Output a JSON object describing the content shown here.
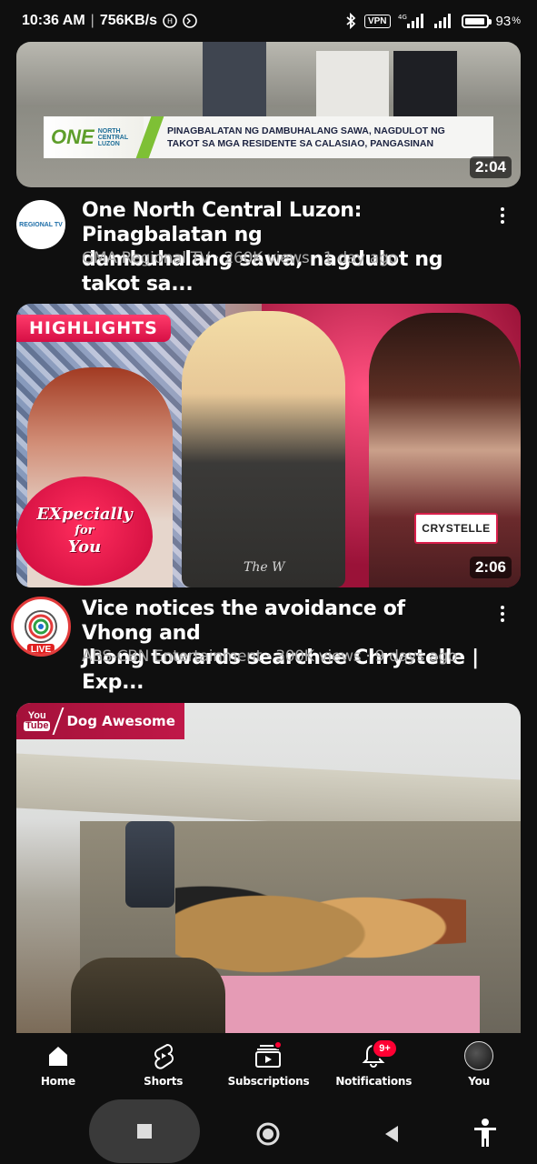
{
  "status_bar": {
    "time": "10:36 AM",
    "speed": "756KB/s",
    "vpn": "VPN",
    "network": "4G",
    "battery": "93",
    "battery_level": 0.93
  },
  "videos": [
    {
      "title_line1": "One North Central Luzon: Pinagbalatan ng",
      "title_line2": "dambuhalang sawa, nagdulot ng takot sa...",
      "subtitle": "GMA Regional TV · 260K views · 1 day ago",
      "duration": "2:04",
      "avatar_text": "REGIONAL TV",
      "lower_third_logo": "ONE",
      "lower_third_logo_sub": [
        "NORTH",
        "CENTRAL",
        "LUZON"
      ],
      "lower_third_line1": "PINAGBALATAN NG DAMBUHALANG SAWA, NAGDULOT NG",
      "lower_third_line2": "TAKOT SA MGA RESIDENTE SA CALASIAO, PANGASINAN"
    },
    {
      "title_line1": "Vice notices the avoidance of Vhong and",
      "title_line2": "Jhong towards searchee Chrystelle | Exp...",
      "subtitle": "ABS-CBN Entertainment · 300K views · 9 days ago",
      "duration": "2:06",
      "highlight_tag": "HIGHLIGHTS",
      "heart_line1": "EXpecially",
      "heart_line2": "for",
      "heart_line3": "You",
      "nameplate": "CRYSTELLE",
      "live_badge": "LIVE",
      "watermark": "The W"
    },
    {
      "channel_tag": "Dog Awesome",
      "yt_top": "You",
      "yt_bottom": "Tube"
    }
  ],
  "bottom_nav": [
    {
      "label": "Home",
      "icon": "home-icon"
    },
    {
      "label": "Shorts",
      "icon": "shorts-icon"
    },
    {
      "label": "Subscriptions",
      "icon": "subscriptions-icon"
    },
    {
      "label": "Notifications",
      "icon": "bell-icon",
      "badge": "9+"
    },
    {
      "label": "You",
      "icon": "avatar"
    }
  ],
  "colors": {
    "background": "#0f0f0f",
    "accent_red": "#ff0033",
    "secondary_text": "#aaaaaa"
  }
}
